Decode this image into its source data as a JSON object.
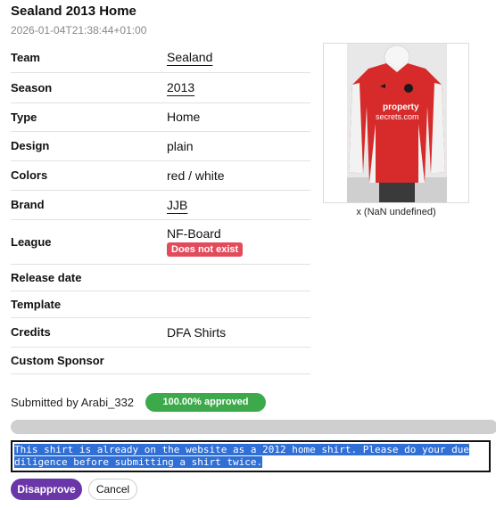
{
  "header": {
    "title": "Sealand 2013 Home",
    "timestamp": "2026-01-04T21:38:44+01:00"
  },
  "details": {
    "team": {
      "label": "Team",
      "value": "Sealand"
    },
    "season": {
      "label": "Season",
      "value": "2013"
    },
    "type": {
      "label": "Type",
      "value": "Home"
    },
    "design": {
      "label": "Design",
      "value": "plain"
    },
    "colors": {
      "label": "Colors",
      "value": "red / white"
    },
    "brand": {
      "label": "Brand",
      "value": "JJB"
    },
    "league": {
      "label": "League",
      "value": "NF-Board",
      "badge": "Does not exist"
    },
    "release_date": {
      "label": "Release date",
      "value": ""
    },
    "template": {
      "label": "Template",
      "value": ""
    },
    "credits": {
      "label": "Credits",
      "value": "DFA Shirts"
    },
    "custom_sponsor": {
      "label": "Custom Sponsor",
      "value": ""
    }
  },
  "photo": {
    "caption": "x (NaN undefined)",
    "shirt_color": "#d72a2a",
    "sleeve_color": "#f2f2f2",
    "sponsor_text_line1": "property",
    "sponsor_text_line2": "secrets.com"
  },
  "submission": {
    "submitted_by": "Submitted by Arabi_332",
    "approval": "100.00% approved",
    "approval_fraction": 1.0
  },
  "comment": {
    "line1": "This shirt is already on the website as a 2012 home shirt. Please do your due",
    "line2": "diligence before submitting a shirt twice."
  },
  "actions": {
    "disapprove_label": "Disapprove",
    "cancel_label": "Cancel"
  },
  "colors": {
    "approved_green": "#3caa4a",
    "disapprove_purple": "#6a37a8",
    "error_red": "#e24b5b",
    "selection_blue": "#2f6fd6"
  }
}
